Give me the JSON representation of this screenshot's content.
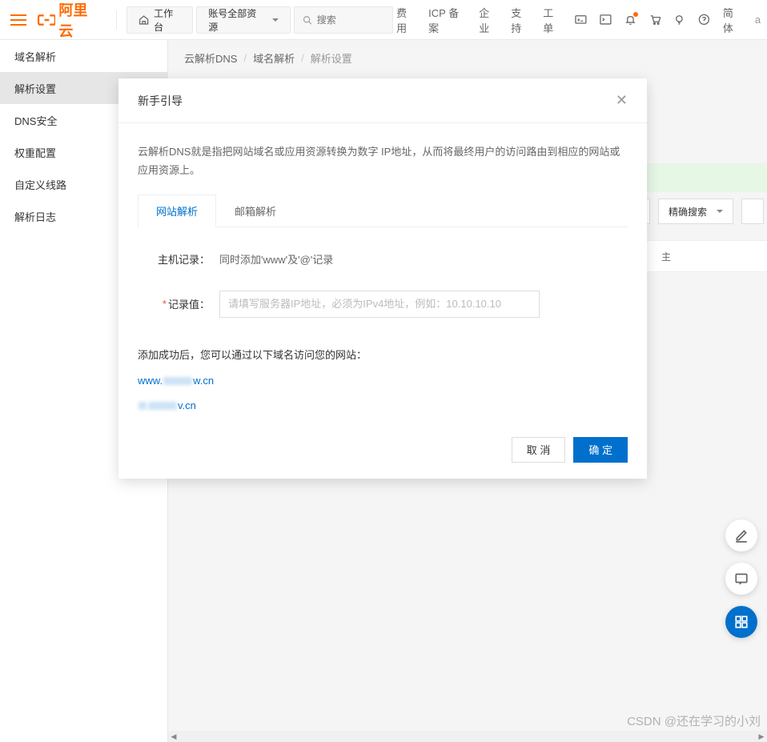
{
  "header": {
    "logo_text": "阿里云",
    "workbench": "工作台",
    "scope": "账号全部资源",
    "search_placeholder": "搜索",
    "links": [
      "费用",
      "ICP 备案",
      "企业",
      "支持",
      "工单"
    ],
    "lang": "简体",
    "truncated": "a"
  },
  "sidebar": {
    "items": [
      {
        "label": "域名解析"
      },
      {
        "label": "解析设置"
      },
      {
        "label": "DNS安全"
      },
      {
        "label": "权重配置"
      },
      {
        "label": "自定义线路"
      },
      {
        "label": "解析日志"
      }
    ],
    "active_index": 1
  },
  "breadcrumb": {
    "a": "云解析DNS",
    "b": "域名解析",
    "c": "解析设置"
  },
  "filters": {
    "precise_search": "精确搜索"
  },
  "table": {
    "hint_fragment": "主"
  },
  "modal": {
    "title": "新手引导",
    "desc": "云解析DNS就是指把网站域名或应用资源转换为数字 IP地址，从而将最终用户的访问路由到相应的网站或应用资源上。",
    "tabs": [
      "网站解析",
      "邮箱解析"
    ],
    "active_tab": 0,
    "host_label": "主机记录：",
    "host_value": "同时添加'www'及'@'记录",
    "record_label": "记录值：",
    "record_placeholder": "请填写服务器IP地址，必须为IPv4地址，例如：10.10.10.10",
    "success_note": "添加成功后，您可以通过以下域名访问您的网站：",
    "domain1_prefix": "www.",
    "domain1_suffix": "w.cn",
    "domain2_suffix": "v.cn",
    "cancel": "取 消",
    "confirm": "确 定"
  },
  "watermark": "CSDN @还在学习的小刘"
}
